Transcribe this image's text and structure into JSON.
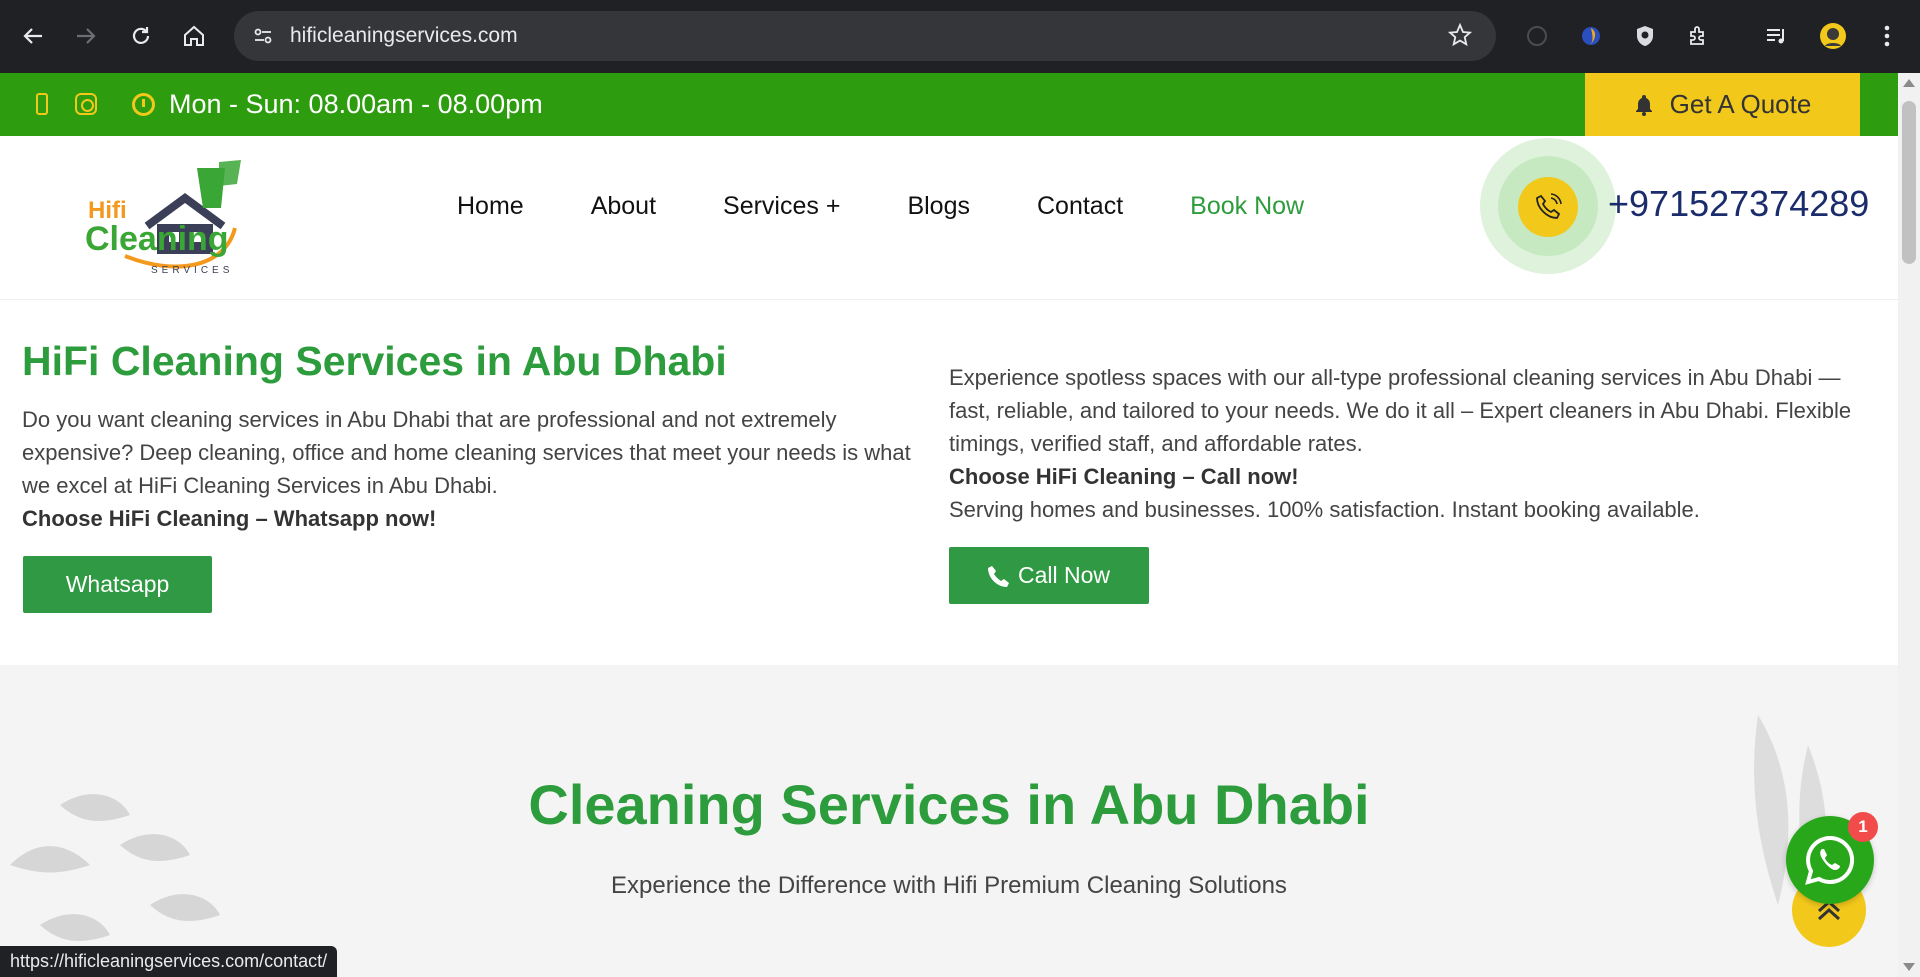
{
  "browser": {
    "url": "hificleaningservices.com",
    "status_url": "https://hificleaningservices.com/contact/"
  },
  "topbar": {
    "hours": "Mon - Sun: 08.00am - 08.00pm",
    "quote_label": "Get A Quote"
  },
  "header": {
    "logo": {
      "line1": "Hifi",
      "line2": "Cleaning",
      "line3": "SERVICES"
    },
    "nav": [
      "Home",
      "About",
      "Services +",
      "Blogs",
      "Contact",
      "Book Now"
    ],
    "phone": "+971527374289"
  },
  "hero": {
    "title": "HiFi Cleaning Services in Abu Dhabi",
    "left_text": "Do you want cleaning services in Abu Dhabi that are professional and not extremely expensive? Deep cleaning, office and home cleaning services that meet your needs is what we excel at HiFi Cleaning Services in Abu Dhabi.",
    "left_cta_text": "Choose HiFi Cleaning – Whatsapp now!",
    "whatsapp_label": "Whatsapp",
    "right_text": "Experience spotless spaces with our all-type professional cleaning services in Abu Dhabi — fast, reliable, and tailored to your needs. We do it all – Expert cleaners in Abu Dhabi. Flexible timings, verified staff, and affordable rates.",
    "right_cta_text": "Choose HiFi Cleaning – Call now!",
    "right_text2": "Serving homes and businesses. 100% satisfaction. Instant booking available.",
    "call_label": "Call Now"
  },
  "section2": {
    "title": "Cleaning Services in Abu Dhabi",
    "subtitle": "Experience the Difference with Hifi Premium Cleaning Solutions"
  },
  "floating": {
    "whatsapp_badge": "1"
  },
  "colors": {
    "brand_green": "#2d9c0e",
    "heading_green": "#2d9c3c",
    "accent_yellow": "#f2c81b",
    "phone_blue": "#1a2c6b"
  }
}
